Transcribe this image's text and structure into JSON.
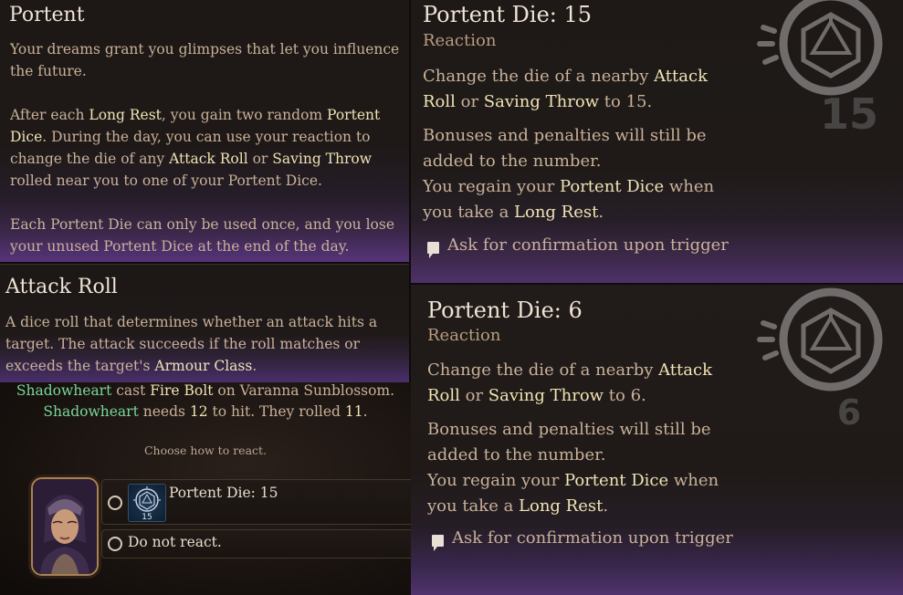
{
  "portent": {
    "title": "Portent",
    "para1": "Your dreams grant you glimpses that let you influence the future.",
    "para2": {
      "t1": "After each ",
      "h1": "Long Rest",
      "t2": ", you gain two random ",
      "h2": "Portent Dice",
      "t3": ". During the day, you can use your reaction to change the die of any ",
      "h3": "Attack Roll",
      "t4": " or ",
      "h4": "Saving Throw",
      "t5": " rolled near you to one of your Portent Dice."
    },
    "para3": "Each Portent Die can only be used once, and you lose your unused Portent Dice at the end of the day."
  },
  "attack_roll": {
    "title": "Attack Roll",
    "t1": "A dice roll that determines whether an attack hits a target. The attack succeeds if the roll matches or exceeds the target's ",
    "h1": "Armour Class",
    "t2": "."
  },
  "combat_log": {
    "line1": {
      "actor": "Shadowheart",
      "t1": " cast ",
      "spell": "Fire Bolt",
      "t2": " on Varanna Sunblossom."
    },
    "line2": {
      "actor": "Shadowheart",
      "t1": " needs ",
      "needed": "12",
      "t2": " to hit. They rolled ",
      "rolled": "11",
      "t3": "."
    }
  },
  "reaction": {
    "prompt": "Choose how to react.",
    "options": [
      {
        "label": "Portent Die: 15",
        "die_value": "15"
      },
      {
        "label": "Do not react."
      }
    ]
  },
  "die_tooltips": [
    {
      "title": "Portent Die: 15",
      "subtitle": "Reaction",
      "b1_t1": "Change the die of a nearby ",
      "b1_h1": "Attack Roll",
      "b1_t2": " or ",
      "b1_h2": "Saving Throw",
      "b1_t3": " to 15.",
      "b2": "Bonuses and penalties will still be added to the number.",
      "b3_t1": "You regain your ",
      "b3_h1": "Portent Dice",
      "b3_t2": " when you take a ",
      "b3_h2": "Long Rest",
      "b3_t3": ".",
      "confirm": "Ask for confirmation upon trigger",
      "die_value": "15"
    },
    {
      "title": "Portent Die: 6",
      "subtitle": "Reaction",
      "b1_t1": "Change the die of a nearby ",
      "b1_h1": "Attack Roll",
      "b1_t2": " or ",
      "b1_h2": "Saving Throw",
      "b1_t3": " to 6.",
      "b2": "Bonuses and penalties will still be added to the number.",
      "b3_t1": "You regain your ",
      "b3_h1": "Portent Dice",
      "b3_t2": " when you take a ",
      "b3_h2": "Long Rest",
      "b3_t3": ".",
      "confirm": "Ask for confirmation upon trigger",
      "die_value": "6"
    }
  ],
  "colors": {
    "highlight": "#f0e3b4",
    "body_text": "#c9b199",
    "character_name": "#79d69a",
    "panel_glow": "#56347a"
  }
}
